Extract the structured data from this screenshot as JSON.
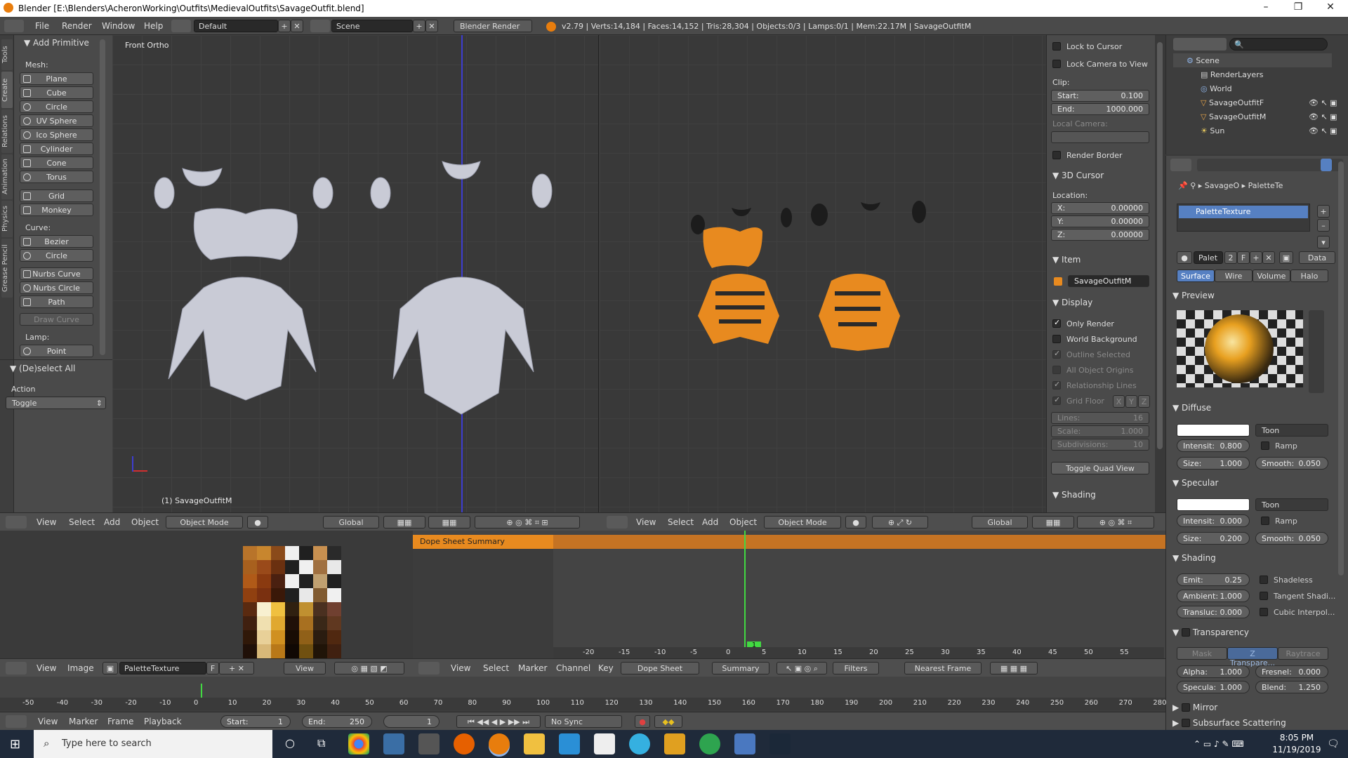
{
  "window": {
    "title": "Blender [E:\\Blenders\\AcheronWorking\\Outfits\\MedievalOutfits\\SavageOutfit.blend]",
    "controls": [
      "–",
      "❐",
      "✕"
    ]
  },
  "infobar": {
    "menus": [
      "File",
      "Render",
      "Window",
      "Help"
    ],
    "layout": "Default",
    "scene": "Scene",
    "engine": "Blender Render",
    "stats": "v2.79 | Verts:14,184 | Faces:14,152 | Tris:28,304 | Objects:0/3 | Lamps:0/1 | Mem:22.17M | SavageOutfitM"
  },
  "toolshelf": {
    "tabs": [
      "Tools",
      "Create",
      "Relations",
      "Animation",
      "Physics",
      "Grease Pencil"
    ],
    "panel_title": "Add Primitive",
    "mesh_label": "Mesh:",
    "mesh": [
      "Plane",
      "Cube",
      "Circle",
      "UV Sphere",
      "Ico Sphere",
      "Cylinder",
      "Cone",
      "Torus",
      "Grid",
      "Monkey"
    ],
    "curve_label": "Curve:",
    "curve": [
      "Bezier",
      "Circle",
      "Nurbs Curve",
      "Nurbs Circle",
      "Path"
    ],
    "draw_curve": "Draw Curve",
    "lamp_label": "Lamp:",
    "lamp": [
      "Point"
    ],
    "deselect_title": "(De)select All",
    "action_label": "Action",
    "action_value": "Toggle"
  },
  "viewport_left": {
    "view_label": "Front Ortho",
    "object_label": "(1) SavageOutfitM",
    "header": [
      "View",
      "Select",
      "Add",
      "Object"
    ],
    "mode": "Object Mode",
    "orientation": "Global"
  },
  "viewport_right": {
    "header": [
      "View",
      "Select",
      "Add",
      "Object"
    ],
    "mode": "Object Mode",
    "orientation": "Global"
  },
  "npanel": {
    "lock_cursor": "Lock to Cursor",
    "lock_camera": "Lock Camera to View",
    "clip": "Clip:",
    "clip_start_label": "Start:",
    "clip_start": "0.100",
    "clip_end_label": "End:",
    "clip_end": "1000.000",
    "local_camera": "Local Camera:",
    "render_border": "Render Border",
    "cursor_title": "3D Cursor",
    "location": "Location:",
    "x_label": "X:",
    "x": "0.00000",
    "y_label": "Y:",
    "y": "0.00000",
    "z_label": "Z:",
    "z": "0.00000",
    "item_title": "Item",
    "item_name": "SavageOutfitM",
    "display_title": "Display",
    "only_render": "Only Render",
    "world_bg": "World Background",
    "outline_selected": "Outline Selected",
    "all_origins": "All Object Origins",
    "rel_lines": "Relationship Lines",
    "grid_floor": "Grid Floor",
    "grid_axes": [
      "X",
      "Y",
      "Z"
    ],
    "lines_label": "Lines:",
    "lines": "16",
    "scale_label": "Scale:",
    "scale": "1.000",
    "subdiv_label": "Subdivisions:",
    "subdiv": "10",
    "toggle_quad": "Toggle Quad View",
    "shading_title": "Shading"
  },
  "outliner": {
    "items": [
      "Scene",
      "RenderLayers",
      "World",
      "SavageOutfitF",
      "SavageOutfitM",
      "Sun"
    ]
  },
  "properties": {
    "breadcrumb": [
      "SavageO",
      "PaletteTe"
    ],
    "slot": "PaletteTexture",
    "mat_name": "Palet",
    "users": "2",
    "fake": "F",
    "data_label": "Data",
    "tabs": [
      "Surface",
      "Wire",
      "Volume",
      "Halo"
    ],
    "preview_title": "Preview",
    "diffuse_title": "Diffuse",
    "diffuse_shader": "Toon",
    "diffuse_intensity_label": "Intensit:",
    "diffuse_intensity": "0.800",
    "ramp": "Ramp",
    "diffuse_size_label": "Size:",
    "diffuse_size": "1.000",
    "diffuse_smooth_label": "Smooth:",
    "diffuse_smooth": "0.050",
    "specular_title": "Specular",
    "specular_shader": "Toon",
    "spec_intensity_label": "Intensit:",
    "spec_intensity": "0.000",
    "spec_size_label": "Size:",
    "spec_size": "0.200",
    "spec_smooth_label": "Smooth:",
    "spec_smooth": "0.050",
    "shading_title": "Shading",
    "emit_label": "Emit:",
    "emit": "0.25",
    "ambient_label": "Ambient:",
    "ambient": "1.000",
    "transluc_label": "Transluc:",
    "transluc": "0.000",
    "shadeless": "Shadeless",
    "tangent": "Tangent Shadi...",
    "cubic": "Cubic Interpol...",
    "transparency_title": "Transparency",
    "trans_modes": [
      "Mask",
      "Z Transpare...",
      "Raytrace"
    ],
    "alpha_label": "Alpha:",
    "alpha": "1.000",
    "fresnel_label": "Fresnel:",
    "fresnel": "0.000",
    "specula_label": "Specula:",
    "specula": "1.000",
    "blend_label": "Blend:",
    "blend": "1.250",
    "mirror_title": "Mirror",
    "sss_title": "Subsurface Scattering"
  },
  "image_editor": {
    "header": [
      "View",
      "Image"
    ],
    "image_name": "PaletteTexture",
    "fake": "F",
    "view": "View"
  },
  "dopesheet": {
    "summary_channel": "Dope Sheet Summary",
    "current_frame": "1",
    "ruler": [
      "-20",
      "-15",
      "-10",
      "-5",
      "0",
      "5",
      "10",
      "15",
      "20",
      "25",
      "30",
      "35",
      "40",
      "45",
      "50",
      "55"
    ],
    "header": [
      "View",
      "Select",
      "Marker",
      "Channel",
      "Key"
    ],
    "mode": "Dope Sheet",
    "summary": "Summary",
    "filters": "Filters",
    "snap": "Nearest Frame"
  },
  "timeline": {
    "ruler": [
      "-50",
      "-40",
      "-30",
      "-20",
      "-10",
      "0",
      "10",
      "20",
      "30",
      "40",
      "50",
      "60",
      "70",
      "80",
      "90",
      "100",
      "110",
      "120",
      "130",
      "140",
      "150",
      "160",
      "170",
      "180",
      "190",
      "200",
      "210",
      "220",
      "230",
      "240",
      "250",
      "260",
      "270",
      "280"
    ],
    "header": [
      "View",
      "Marker",
      "Frame",
      "Playback"
    ],
    "start_label": "Start:",
    "start": "1",
    "end_label": "End:",
    "end": "250",
    "current": "1",
    "sync": "No Sync"
  },
  "taskbar": {
    "search_placeholder": "Type here to search",
    "time": "8:05 PM",
    "date": "11/19/2019"
  },
  "colors": {
    "accent": "#5680c2",
    "orange": "#e88a1f",
    "active_tab": "#5680c2"
  }
}
